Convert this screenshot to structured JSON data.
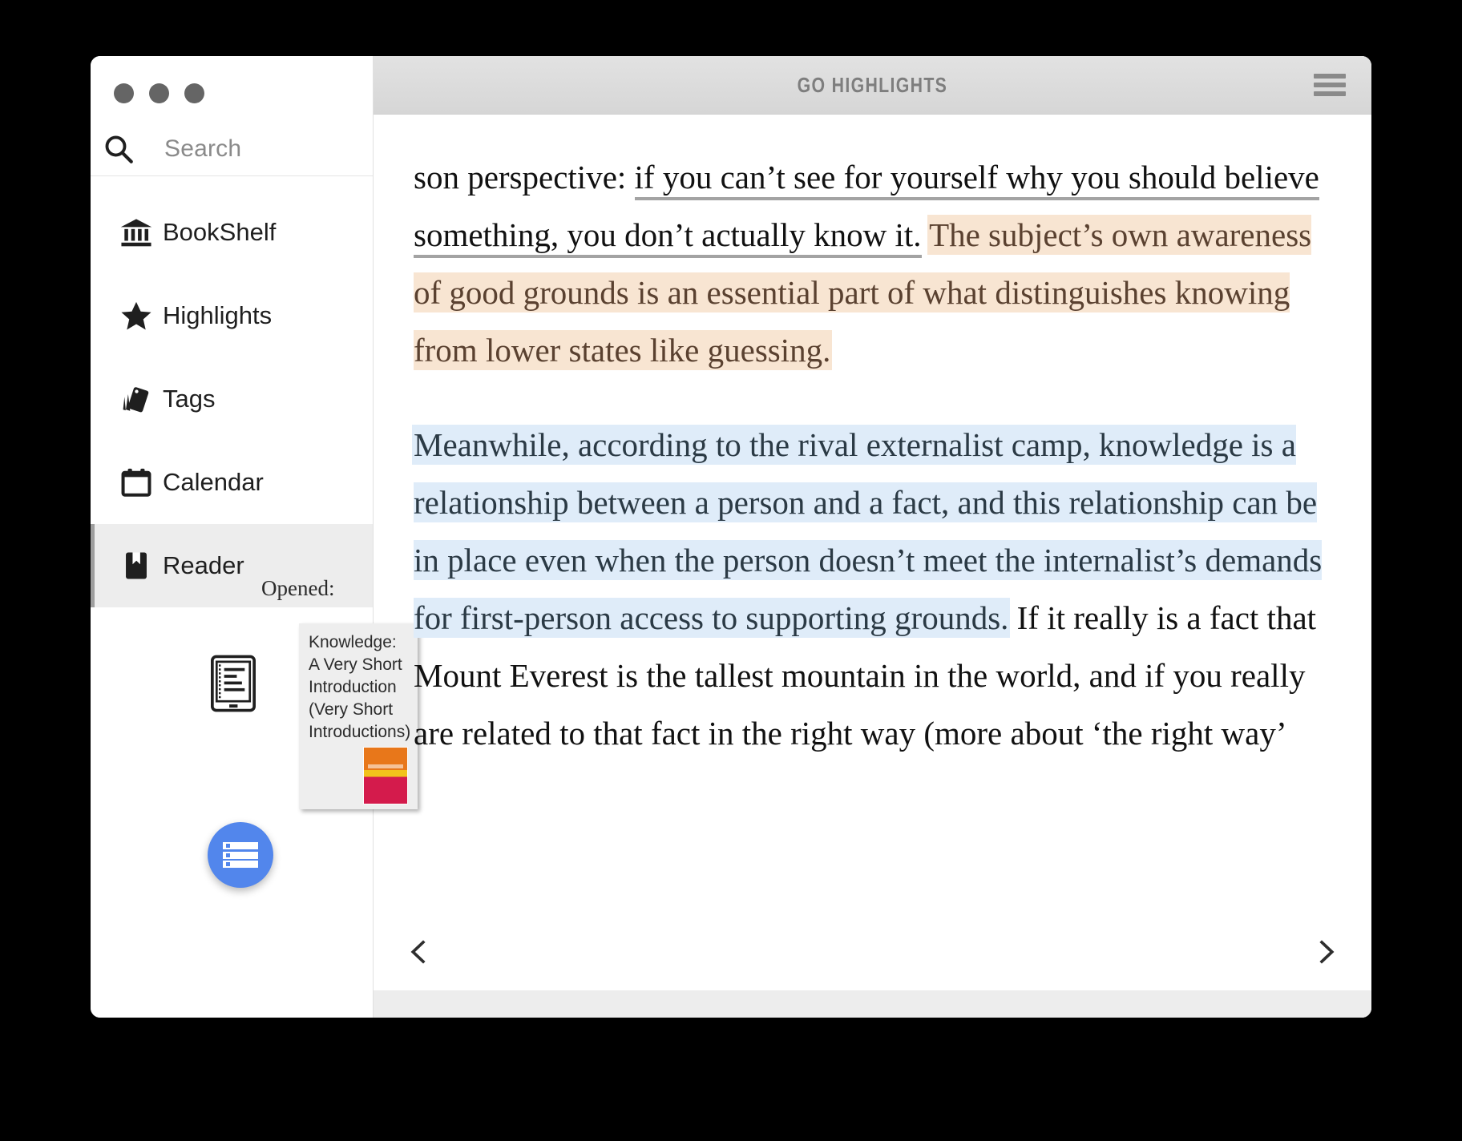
{
  "window": {
    "traffic_lights": [
      "close",
      "minimize",
      "zoom"
    ],
    "title": "GO HIGHLIGHTS",
    "menu_icon": "hamburger-menu-icon"
  },
  "sidebar": {
    "search": {
      "placeholder": "Search",
      "value": "",
      "icon": "search-icon"
    },
    "items": [
      {
        "label": "BookShelf",
        "icon": "bank-bookshelf-icon",
        "active": false
      },
      {
        "label": "Highlights",
        "icon": "star-icon",
        "active": false
      },
      {
        "label": "Tags",
        "icon": "tags-icon",
        "active": false
      },
      {
        "label": "Calendar",
        "icon": "calendar-icon",
        "active": false
      },
      {
        "label": "Reader",
        "icon": "bookmark-book-icon",
        "active": true
      }
    ],
    "opened_label": "Opened:",
    "opened_book": {
      "thumbnail_icon": "ereader-device-icon",
      "tooltip_title": "Knowledge: A Very Short Introduction (Very Short Introductions)",
      "cover_colors": [
        "#e8771a",
        "#f2c21b",
        "#d41b4c"
      ]
    },
    "fab": {
      "icon": "list-view-icon",
      "color": "#5286ec"
    }
  },
  "reader": {
    "paragraphs": [
      {
        "segments": [
          {
            "text": "son perspective: ",
            "style": "plain"
          },
          {
            "text": "if you can’t see for yourself why you should believe something, you don’t actually know it.",
            "style": "underline"
          },
          {
            "text": " ",
            "style": "plain"
          },
          {
            "text": "The subject’s own awareness of good grounds is an essential part of what distinguishes knowing from lower states like guessing.",
            "style": "peach-highlight"
          }
        ]
      },
      {
        "segments": [
          {
            "text": "Meanwhile, according to the rival externalist camp, knowl­edge is a relationship between a person and a fact, and this relationship can be in place even when the person doesn’t meet the internalist’s demands for first-person access to supporting grounds.",
            "style": "blue-highlight"
          },
          {
            "text": " If it really is a fact that Mount Everest is the tallest mountain in the world, and if you really are relat­ed to that fact in the right way (more about ‘the right way’",
            "style": "plain"
          }
        ]
      }
    ],
    "prev_label": "‹",
    "next_label": "›"
  },
  "colors": {
    "peach_highlight": "#f8e5d2",
    "peach_text": "#5a4130",
    "blue_highlight": "#dfecf9",
    "blue_text": "#2b3a45",
    "underline": "#a3a3a3",
    "accent": "#5286ec",
    "titlebar_text": "#7e7e7e"
  }
}
